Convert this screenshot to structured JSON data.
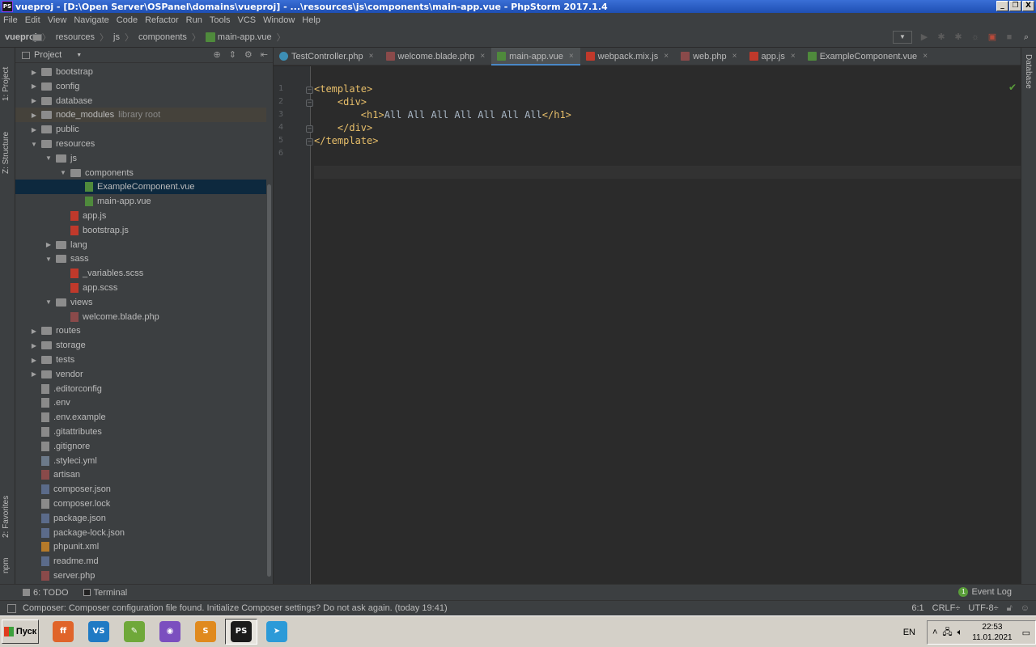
{
  "window": {
    "title": "vueproj - [D:\\Open Server\\OSPanel\\domains\\vueproj] - ...\\resources\\js\\components\\main-app.vue - PhpStorm 2017.1.4",
    "buttons": [
      "_",
      "❐",
      "X"
    ]
  },
  "menu": [
    "File",
    "Edit",
    "View",
    "Navigate",
    "Code",
    "Refactor",
    "Run",
    "Tools",
    "VCS",
    "Window",
    "Help"
  ],
  "breadcrumb": [
    "vueproj",
    "resources",
    "js",
    "components",
    "main-app.vue"
  ],
  "left_strip": {
    "project": "1: Project",
    "structure": "Z: Structure",
    "favorites": "2: Favorites",
    "npm": "npm"
  },
  "right_strip": {
    "database": "Database"
  },
  "project_panel": {
    "title": "Project"
  },
  "tree": [
    {
      "label": "bootstrap",
      "kind": "folder",
      "depth": 1,
      "arrow": "▶"
    },
    {
      "label": "config",
      "kind": "folder",
      "depth": 1,
      "arrow": "▶"
    },
    {
      "label": "database",
      "kind": "folder",
      "depth": 1,
      "arrow": "▶"
    },
    {
      "label": "node_modules",
      "kind": "folder",
      "depth": 1,
      "arrow": "▶",
      "hint": "library root"
    },
    {
      "label": "public",
      "kind": "folder",
      "depth": 1,
      "arrow": "▶"
    },
    {
      "label": "resources",
      "kind": "folder",
      "depth": 1,
      "arrow": "▼"
    },
    {
      "label": "js",
      "kind": "folder",
      "depth": 2,
      "arrow": "▼"
    },
    {
      "label": "components",
      "kind": "folder",
      "depth": 3,
      "arrow": "▼"
    },
    {
      "label": "ExampleComponent.vue",
      "kind": "vue",
      "depth": 4,
      "selected": true
    },
    {
      "label": "main-app.vue",
      "kind": "vue",
      "depth": 4
    },
    {
      "label": "app.js",
      "kind": "js",
      "depth": 3
    },
    {
      "label": "bootstrap.js",
      "kind": "js",
      "depth": 3
    },
    {
      "label": "lang",
      "kind": "folder",
      "depth": 2,
      "arrow": "▶"
    },
    {
      "label": "sass",
      "kind": "folder",
      "depth": 2,
      "arrow": "▼"
    },
    {
      "label": "_variables.scss",
      "kind": "scss",
      "depth": 3
    },
    {
      "label": "app.scss",
      "kind": "scss",
      "depth": 3
    },
    {
      "label": "views",
      "kind": "folder",
      "depth": 2,
      "arrow": "▼"
    },
    {
      "label": "welcome.blade.php",
      "kind": "php",
      "depth": 3
    },
    {
      "label": "routes",
      "kind": "folder",
      "depth": 1,
      "arrow": "▶"
    },
    {
      "label": "storage",
      "kind": "folder",
      "depth": 1,
      "arrow": "▶"
    },
    {
      "label": "tests",
      "kind": "folder",
      "depth": 1,
      "arrow": "▶"
    },
    {
      "label": "vendor",
      "kind": "folder",
      "depth": 1,
      "arrow": "▶"
    },
    {
      "label": ".editorconfig",
      "kind": "text",
      "depth": 1
    },
    {
      "label": ".env",
      "kind": "text",
      "depth": 1
    },
    {
      "label": ".env.example",
      "kind": "text",
      "depth": 1
    },
    {
      "label": ".gitattributes",
      "kind": "text",
      "depth": 1
    },
    {
      "label": ".gitignore",
      "kind": "text",
      "depth": 1
    },
    {
      "label": ".styleci.yml",
      "kind": "yml",
      "depth": 1
    },
    {
      "label": "artisan",
      "kind": "php",
      "depth": 1
    },
    {
      "label": "composer.json",
      "kind": "json",
      "depth": 1
    },
    {
      "label": "composer.lock",
      "kind": "text",
      "depth": 1
    },
    {
      "label": "package.json",
      "kind": "json",
      "depth": 1
    },
    {
      "label": "package-lock.json",
      "kind": "json",
      "depth": 1
    },
    {
      "label": "phpunit.xml",
      "kind": "xml",
      "depth": 1
    },
    {
      "label": "readme.md",
      "kind": "md",
      "depth": 1
    },
    {
      "label": "server.php",
      "kind": "php",
      "depth": 1
    }
  ],
  "tabs": [
    {
      "label": "TestController.php",
      "icon": "c"
    },
    {
      "label": "welcome.blade.php",
      "icon": "php"
    },
    {
      "label": "main-app.vue",
      "icon": "vue",
      "active": true
    },
    {
      "label": "webpack.mix.js",
      "icon": "js"
    },
    {
      "label": "web.php",
      "icon": "php"
    },
    {
      "label": "app.js",
      "icon": "js"
    },
    {
      "label": "ExampleComponent.vue",
      "icon": "vue"
    }
  ],
  "tab_close": "×",
  "code": {
    "line_numbers": [
      "1",
      "2",
      "3",
      "4",
      "5",
      "6"
    ],
    "lines": [
      [
        {
          "t": "<template>",
          "c": "tag"
        }
      ],
      [
        {
          "t": "    ",
          "c": "txt"
        },
        {
          "t": "<div>",
          "c": "tag"
        }
      ],
      [
        {
          "t": "        ",
          "c": "txt"
        },
        {
          "t": "<h1>",
          "c": "tag"
        },
        {
          "t": "All All All All All All All",
          "c": "txt"
        },
        {
          "t": "</h1>",
          "c": "tag"
        }
      ],
      [
        {
          "t": "    ",
          "c": "txt"
        },
        {
          "t": "</div>",
          "c": "tag"
        }
      ],
      [
        {
          "t": "</template>",
          "c": "tag"
        }
      ],
      []
    ]
  },
  "bottom_tools": {
    "todo": "6: TODO",
    "terminal": "Terminal",
    "event_log": "Event Log",
    "event_count": "1"
  },
  "status": {
    "message": "Composer: Composer configuration file found. Initialize Composer settings? Do not ask again. (today 19:41)",
    "position": "6:1",
    "line_sep": "CRLF÷",
    "encoding": "UTF-8÷"
  },
  "taskbar": {
    "start": "Пуск",
    "apps": [
      {
        "name": "firefox",
        "color": "#e0642a",
        "glyph": "ff"
      },
      {
        "name": "vscode",
        "color": "#1f7ac4",
        "glyph": "VS"
      },
      {
        "name": "notepad",
        "color": "#6fa83a",
        "glyph": "✎"
      },
      {
        "name": "openserver",
        "color": "#7b4fbf",
        "glyph": "◉"
      },
      {
        "name": "sublime",
        "color": "#e08a1e",
        "glyph": "S"
      },
      {
        "name": "phpstorm",
        "color": "#1b1b1b",
        "glyph": "PS",
        "active": true
      },
      {
        "name": "telegram",
        "color": "#2c9ad8",
        "glyph": "➤"
      }
    ],
    "lang": "EN",
    "time": "22:53",
    "date": "11.01.2021"
  }
}
